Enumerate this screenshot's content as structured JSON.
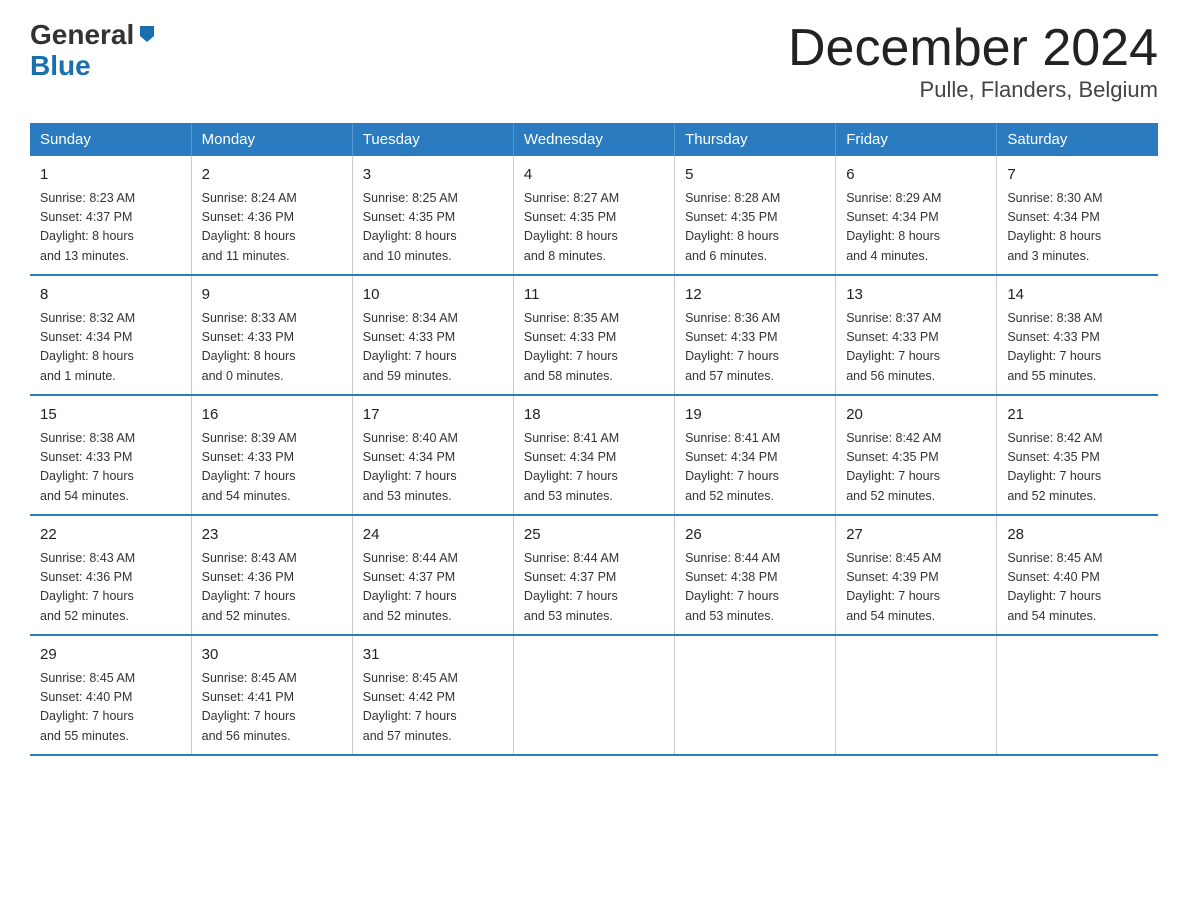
{
  "header": {
    "title": "December 2024",
    "subtitle": "Pulle, Flanders, Belgium",
    "logo_general": "General",
    "logo_blue": "Blue"
  },
  "columns": [
    "Sunday",
    "Monday",
    "Tuesday",
    "Wednesday",
    "Thursday",
    "Friday",
    "Saturday"
  ],
  "weeks": [
    [
      {
        "day": "1",
        "info": "Sunrise: 8:23 AM\nSunset: 4:37 PM\nDaylight: 8 hours\nand 13 minutes."
      },
      {
        "day": "2",
        "info": "Sunrise: 8:24 AM\nSunset: 4:36 PM\nDaylight: 8 hours\nand 11 minutes."
      },
      {
        "day": "3",
        "info": "Sunrise: 8:25 AM\nSunset: 4:35 PM\nDaylight: 8 hours\nand 10 minutes."
      },
      {
        "day": "4",
        "info": "Sunrise: 8:27 AM\nSunset: 4:35 PM\nDaylight: 8 hours\nand 8 minutes."
      },
      {
        "day": "5",
        "info": "Sunrise: 8:28 AM\nSunset: 4:35 PM\nDaylight: 8 hours\nand 6 minutes."
      },
      {
        "day": "6",
        "info": "Sunrise: 8:29 AM\nSunset: 4:34 PM\nDaylight: 8 hours\nand 4 minutes."
      },
      {
        "day": "7",
        "info": "Sunrise: 8:30 AM\nSunset: 4:34 PM\nDaylight: 8 hours\nand 3 minutes."
      }
    ],
    [
      {
        "day": "8",
        "info": "Sunrise: 8:32 AM\nSunset: 4:34 PM\nDaylight: 8 hours\nand 1 minute."
      },
      {
        "day": "9",
        "info": "Sunrise: 8:33 AM\nSunset: 4:33 PM\nDaylight: 8 hours\nand 0 minutes."
      },
      {
        "day": "10",
        "info": "Sunrise: 8:34 AM\nSunset: 4:33 PM\nDaylight: 7 hours\nand 59 minutes."
      },
      {
        "day": "11",
        "info": "Sunrise: 8:35 AM\nSunset: 4:33 PM\nDaylight: 7 hours\nand 58 minutes."
      },
      {
        "day": "12",
        "info": "Sunrise: 8:36 AM\nSunset: 4:33 PM\nDaylight: 7 hours\nand 57 minutes."
      },
      {
        "day": "13",
        "info": "Sunrise: 8:37 AM\nSunset: 4:33 PM\nDaylight: 7 hours\nand 56 minutes."
      },
      {
        "day": "14",
        "info": "Sunrise: 8:38 AM\nSunset: 4:33 PM\nDaylight: 7 hours\nand 55 minutes."
      }
    ],
    [
      {
        "day": "15",
        "info": "Sunrise: 8:38 AM\nSunset: 4:33 PM\nDaylight: 7 hours\nand 54 minutes."
      },
      {
        "day": "16",
        "info": "Sunrise: 8:39 AM\nSunset: 4:33 PM\nDaylight: 7 hours\nand 54 minutes."
      },
      {
        "day": "17",
        "info": "Sunrise: 8:40 AM\nSunset: 4:34 PM\nDaylight: 7 hours\nand 53 minutes."
      },
      {
        "day": "18",
        "info": "Sunrise: 8:41 AM\nSunset: 4:34 PM\nDaylight: 7 hours\nand 53 minutes."
      },
      {
        "day": "19",
        "info": "Sunrise: 8:41 AM\nSunset: 4:34 PM\nDaylight: 7 hours\nand 52 minutes."
      },
      {
        "day": "20",
        "info": "Sunrise: 8:42 AM\nSunset: 4:35 PM\nDaylight: 7 hours\nand 52 minutes."
      },
      {
        "day": "21",
        "info": "Sunrise: 8:42 AM\nSunset: 4:35 PM\nDaylight: 7 hours\nand 52 minutes."
      }
    ],
    [
      {
        "day": "22",
        "info": "Sunrise: 8:43 AM\nSunset: 4:36 PM\nDaylight: 7 hours\nand 52 minutes."
      },
      {
        "day": "23",
        "info": "Sunrise: 8:43 AM\nSunset: 4:36 PM\nDaylight: 7 hours\nand 52 minutes."
      },
      {
        "day": "24",
        "info": "Sunrise: 8:44 AM\nSunset: 4:37 PM\nDaylight: 7 hours\nand 52 minutes."
      },
      {
        "day": "25",
        "info": "Sunrise: 8:44 AM\nSunset: 4:37 PM\nDaylight: 7 hours\nand 53 minutes."
      },
      {
        "day": "26",
        "info": "Sunrise: 8:44 AM\nSunset: 4:38 PM\nDaylight: 7 hours\nand 53 minutes."
      },
      {
        "day": "27",
        "info": "Sunrise: 8:45 AM\nSunset: 4:39 PM\nDaylight: 7 hours\nand 54 minutes."
      },
      {
        "day": "28",
        "info": "Sunrise: 8:45 AM\nSunset: 4:40 PM\nDaylight: 7 hours\nand 54 minutes."
      }
    ],
    [
      {
        "day": "29",
        "info": "Sunrise: 8:45 AM\nSunset: 4:40 PM\nDaylight: 7 hours\nand 55 minutes."
      },
      {
        "day": "30",
        "info": "Sunrise: 8:45 AM\nSunset: 4:41 PM\nDaylight: 7 hours\nand 56 minutes."
      },
      {
        "day": "31",
        "info": "Sunrise: 8:45 AM\nSunset: 4:42 PM\nDaylight: 7 hours\nand 57 minutes."
      },
      {
        "day": "",
        "info": ""
      },
      {
        "day": "",
        "info": ""
      },
      {
        "day": "",
        "info": ""
      },
      {
        "day": "",
        "info": ""
      }
    ]
  ]
}
